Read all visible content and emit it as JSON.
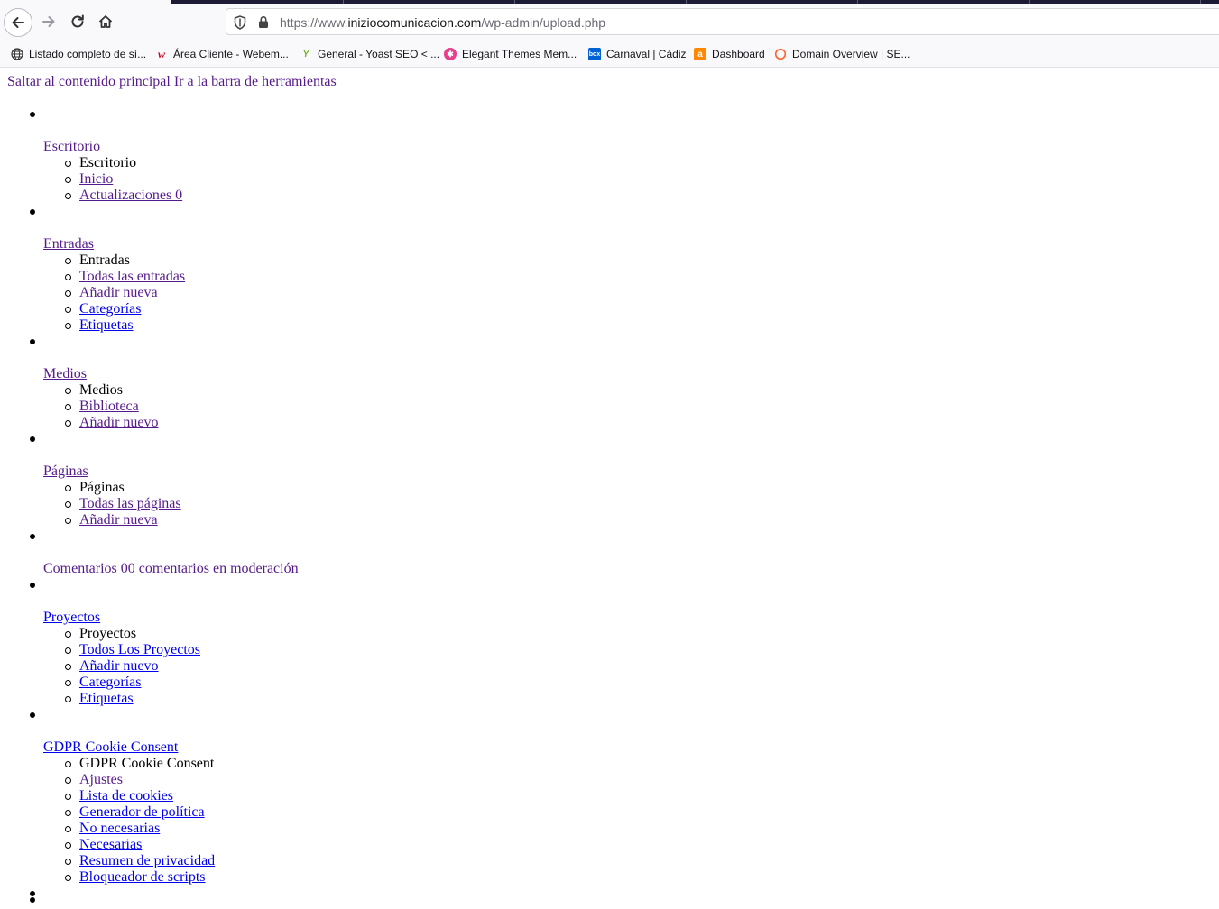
{
  "browser": {
    "url_prefix": "https://www.",
    "url_domain": "iniziocomunicacion.com",
    "url_path": "/wp-admin/upload.php",
    "bookmarks": [
      {
        "label": "Listado completo de sí...",
        "icon": "globe-icon",
        "color": "#333333"
      },
      {
        "label": "Área Cliente - Webem...",
        "icon": "webempresa-icon",
        "color": "#d0021b"
      },
      {
        "label": "General - Yoast SEO < ...",
        "icon": "yoast-icon",
        "color": "#77b227"
      },
      {
        "label": "Elegant Themes Mem...",
        "icon": "elegant-themes-icon",
        "color": "#e83e8c"
      },
      {
        "label": "Carnaval | Cádiz",
        "icon": "box-icon",
        "color": "#0061d5"
      },
      {
        "label": "Dashboard",
        "icon": "ahrefs-icon",
        "color": "#ff8800"
      },
      {
        "label": "Domain Overview | SE...",
        "icon": "semrush-icon",
        "color": "#ff642d"
      }
    ]
  },
  "page": {
    "skip_main": "Saltar al contenido principal",
    "skip_toolbar": "Ir a la barra de herramientas",
    "menu": [
      {
        "label": "Escritorio",
        "visited": true,
        "sub": [
          {
            "label": "Escritorio",
            "link": false
          },
          {
            "label": "Inicio",
            "link": true,
            "visited": true
          },
          {
            "label": "Actualizaciones 0",
            "link": true,
            "visited": true
          }
        ]
      },
      {
        "label": "Entradas",
        "visited": true,
        "sub": [
          {
            "label": "Entradas",
            "link": false
          },
          {
            "label": "Todas las entradas",
            "link": true,
            "visited": true
          },
          {
            "label": "Añadir nueva",
            "link": true,
            "visited": true
          },
          {
            "label": "Categorías",
            "link": true,
            "visited": false
          },
          {
            "label": "Etiquetas",
            "link": true,
            "visited": false
          }
        ]
      },
      {
        "label": "Medios",
        "visited": true,
        "sub": [
          {
            "label": "Medios",
            "link": false
          },
          {
            "label": "Biblioteca",
            "link": true,
            "visited": true
          },
          {
            "label": "Añadir nuevo",
            "link": true,
            "visited": true
          }
        ]
      },
      {
        "label": "Páginas",
        "visited": true,
        "sub": [
          {
            "label": "Páginas",
            "link": false
          },
          {
            "label": "Todas las páginas",
            "link": true,
            "visited": true
          },
          {
            "label": "Añadir nueva",
            "link": true,
            "visited": true
          }
        ]
      },
      {
        "label": "Comentarios 00 comentarios en moderación",
        "visited": true,
        "sub": []
      },
      {
        "label": "Proyectos",
        "visited": false,
        "sub": [
          {
            "label": "Proyectos",
            "link": false
          },
          {
            "label": "Todos Los Proyectos",
            "link": true,
            "visited": false
          },
          {
            "label": "Añadir nuevo",
            "link": true,
            "visited": false
          },
          {
            "label": "Categorías",
            "link": true,
            "visited": false
          },
          {
            "label": "Etiquetas",
            "link": true,
            "visited": false
          }
        ]
      },
      {
        "label": "GDPR Cookie Consent",
        "visited": false,
        "sub": [
          {
            "label": "GDPR Cookie Consent",
            "link": false
          },
          {
            "label": "Ajustes",
            "link": true,
            "visited": true
          },
          {
            "label": "Lista de cookies",
            "link": true,
            "visited": false
          },
          {
            "label": "Generador de política",
            "link": true,
            "visited": false
          },
          {
            "label": "No necesarias",
            "link": true,
            "visited": false
          },
          {
            "label": "Necesarias",
            "link": true,
            "visited": false
          },
          {
            "label": "Resumen de privacidad",
            "link": true,
            "visited": false
          },
          {
            "label": "Bloqueador de scripts",
            "link": true,
            "visited": false
          }
        ]
      },
      {
        "label": "",
        "visited": false,
        "sub": []
      }
    ]
  }
}
